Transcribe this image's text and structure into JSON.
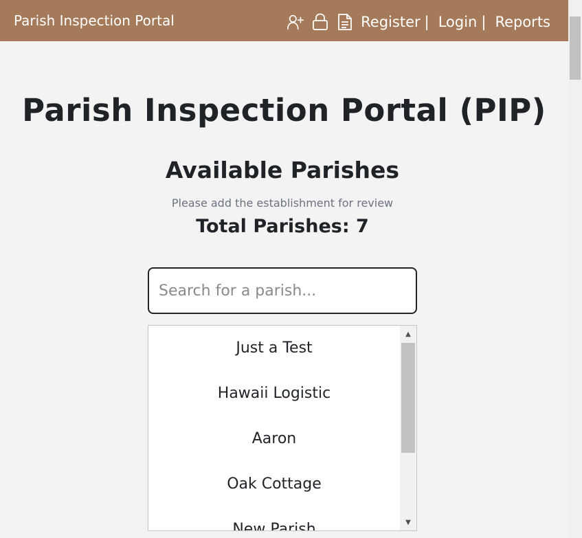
{
  "navbar": {
    "brand": "Parish Inspection Portal",
    "icons": [
      "add-user-icon",
      "lock-icon",
      "document-icon"
    ],
    "links": [
      {
        "label": "Register"
      },
      {
        "label": "Login"
      },
      {
        "label": "Reports"
      }
    ],
    "separator": "|",
    "background_color": "#a57a5a"
  },
  "main": {
    "title": "Parish Inspection Portal (PIP)",
    "section_title": "Available Parishes",
    "subtitle": "Please add the establishment for review",
    "total": "Total Parishes: 7"
  },
  "search": {
    "placeholder": "Search for a parish...",
    "value": ""
  },
  "parish_list": {
    "items": [
      "Just a Test",
      "Hawaii Logistic",
      "Aaron",
      "Oak Cottage",
      "New Parish"
    ]
  }
}
